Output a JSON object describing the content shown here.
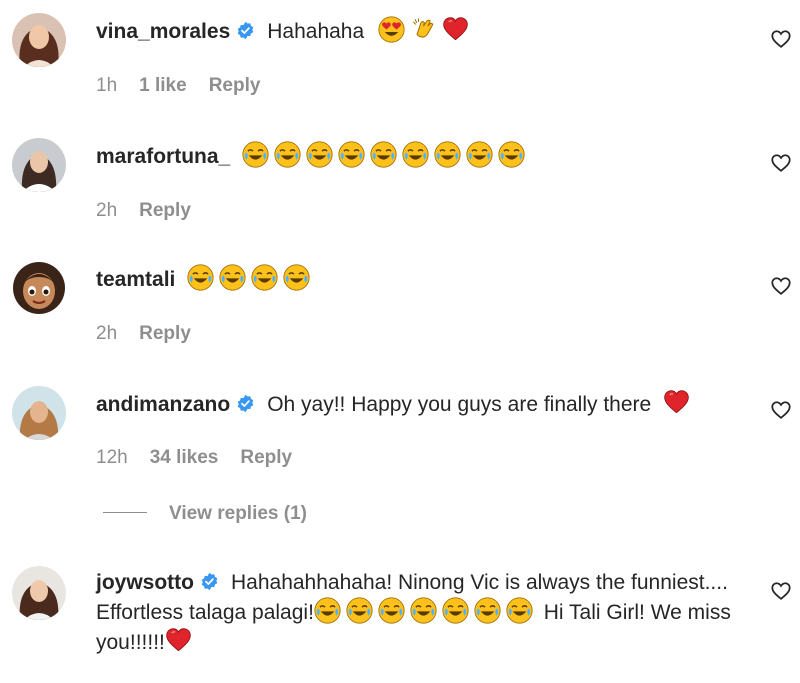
{
  "comments": [
    {
      "username": "vina_morales",
      "verified": true,
      "text": "Hahahaha",
      "emojis": [
        "heart-eyes",
        "clap",
        "red-heart"
      ],
      "time": "1h",
      "likes": "1 like",
      "reply": "Reply"
    },
    {
      "username": "marafortuna_",
      "verified": false,
      "text": "",
      "emojis": [
        "joy",
        "joy",
        "joy",
        "joy",
        "joy",
        "joy",
        "joy",
        "joy",
        "joy"
      ],
      "time": "2h",
      "likes": "",
      "reply": "Reply"
    },
    {
      "username": "teamtali",
      "verified": false,
      "text": "",
      "emojis": [
        "joy",
        "joy",
        "joy",
        "joy"
      ],
      "time": "2h",
      "likes": "",
      "reply": "Reply"
    },
    {
      "username": "andimanzano",
      "verified": true,
      "text": "Oh yay!! Happy you guys are finally there",
      "emojis": [
        "red-heart"
      ],
      "time": "12h",
      "likes": "34 likes",
      "reply": "Reply"
    },
    {
      "username": "joywsotto",
      "verified": true,
      "text_part1": "Hahahahhahaha! Ninong Vic is always the funniest.... Effortless talaga palagi!",
      "text_part2": "Hi Tali Girl! We miss you!!!!!!",
      "emojis": [
        "joy",
        "joy",
        "joy",
        "joy",
        "joy",
        "joy",
        "joy"
      ],
      "end_emoji": "red-heart"
    }
  ],
  "view_replies": "View replies (1)",
  "colors": {
    "text": "#262626",
    "muted": "#8e8e8e",
    "verified": "#3897f0",
    "heart": "#ed4956",
    "emoji": "#fcc21b"
  }
}
